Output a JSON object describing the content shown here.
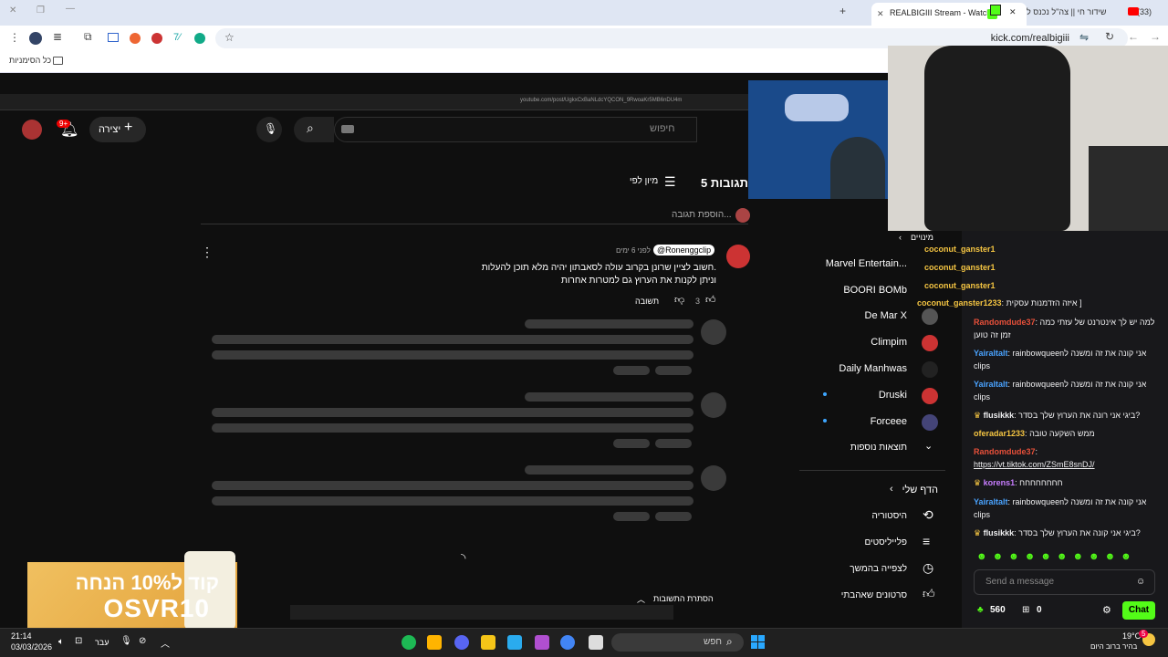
{
  "browser": {
    "tabs": [
      {
        "label": "REALBIGIII Stream - Watch",
        "active": true
      },
      {
        "label": "שידור חי || צה\"ל נכנס ל"
      },
      {
        "label": "(33)"
      }
    ],
    "url": "kick.com/realbigiii",
    "bookmarks_label": "כל הסימניות"
  },
  "inner_video": {
    "youtube": {
      "create_label": "יצירה",
      "notif_count": "9+",
      "search_placeholder": "חיפוש",
      "comments_title": "5 תגובות",
      "sort_label": "מיון לפי",
      "add_reply_placeholder": "הוספת תגובה...",
      "comment": {
        "author": "@Ronenggclip",
        "time": "לפני 6 ימים",
        "line1": "חשוב לציין שרונן בקרוב עולה לסאבתון יהיה מלא תוכן להעלות.",
        "line2": "וניתן לקנות את הערוץ גם למטרות אחרות",
        "likes": "3",
        "reply_label": "תשובה"
      },
      "hide_replies_label": "הסתרת התשובות",
      "sidebar": {
        "channels": [
          {
            "name": "Marvel Entertain...",
            "color": "#b22"
          },
          {
            "name": "BOORI BOMb",
            "color": "#b22"
          },
          {
            "name": "De Mar X",
            "color": "#555"
          },
          {
            "name": "Climpim",
            "color": "#c33"
          },
          {
            "name": "Daily Manhwas",
            "color": "#222"
          },
          {
            "name": "Druski",
            "color": "#c33"
          },
          {
            "name": "Forceee",
            "color": "#447"
          }
        ],
        "more_results": "תוצאות נוספות",
        "my_page": "הדף שלי",
        "history": "היסטוריה",
        "playlists": "פלייליסטים",
        "watch_later": "לצפייה בהמשך",
        "liked_videos": "סרטונים שאהבתי",
        "subscriptions_header": "מינויים"
      }
    },
    "url_bar": "youtube.com/post/UgkxCxBaNLdcYQCON_9RwoaKr5MB6nDU4m"
  },
  "chat": {
    "messages": [
      {
        "user": "coconut_ganster1",
        "color": "#f5c542",
        "text": ""
      },
      {
        "user": "coconut_ganster1",
        "color": "#f5c542",
        "text": ""
      },
      {
        "user": "coconut_ganster1",
        "color": "#f5c542",
        "text": ""
      },
      {
        "user": "coconut_ganster1233",
        "color": "#f5c542",
        "text": "איזה הזדמנות עסקית ]"
      },
      {
        "user": "Randomdude37",
        "color": "#e8503a",
        "text": "למה יש לך אינטרנט של עזתי כמה זמן זה טוען"
      },
      {
        "user": "Yairaltalt",
        "color": "#4aa3ff",
        "text": "rainbowqueenאני קונה את זה ומשנה ל clips"
      },
      {
        "user": "Yairaltalt",
        "color": "#4aa3ff",
        "text": "rainbowqueenאני קונה את זה ומשנה ל clips"
      },
      {
        "user": "flusikkk",
        "color": "#ffffff",
        "text": "ביגי אני רונה את הערוץ שלך בסדר?"
      },
      {
        "user": "oferadar1233",
        "color": "#f5c542",
        "text": "ממש השקעה טובה"
      },
      {
        "user": "Randomdude37",
        "color": "#e8503a",
        "text": "https://vt.tiktok.com/ZSmE8snDJ/"
      },
      {
        "user": "korens1",
        "color": "#c77dff",
        "text": "חחחחחחחח"
      },
      {
        "user": "Yairaltalt",
        "color": "#4aa3ff",
        "text": "rainbowqueenאני קונה את זה ומשנה ל clips"
      },
      {
        "user": "flusikkk",
        "color": "#ffffff",
        "text": "ביגי אני קונה את הערוץ שלך בסדר?"
      }
    ],
    "input_placeholder": "Send a message",
    "points": "560",
    "gifts": "0",
    "send_label": "Chat"
  },
  "promo": {
    "line1": "קוד ל10% הנחה",
    "line2": "OSVR10"
  },
  "taskbar": {
    "time": "21:14",
    "date": "03/03/2026",
    "search_placeholder": "חפש",
    "weather_temp": "19°C",
    "weather_desc": "בהיר ברוב היום",
    "lang": "עבר",
    "notif_badge": "5"
  }
}
